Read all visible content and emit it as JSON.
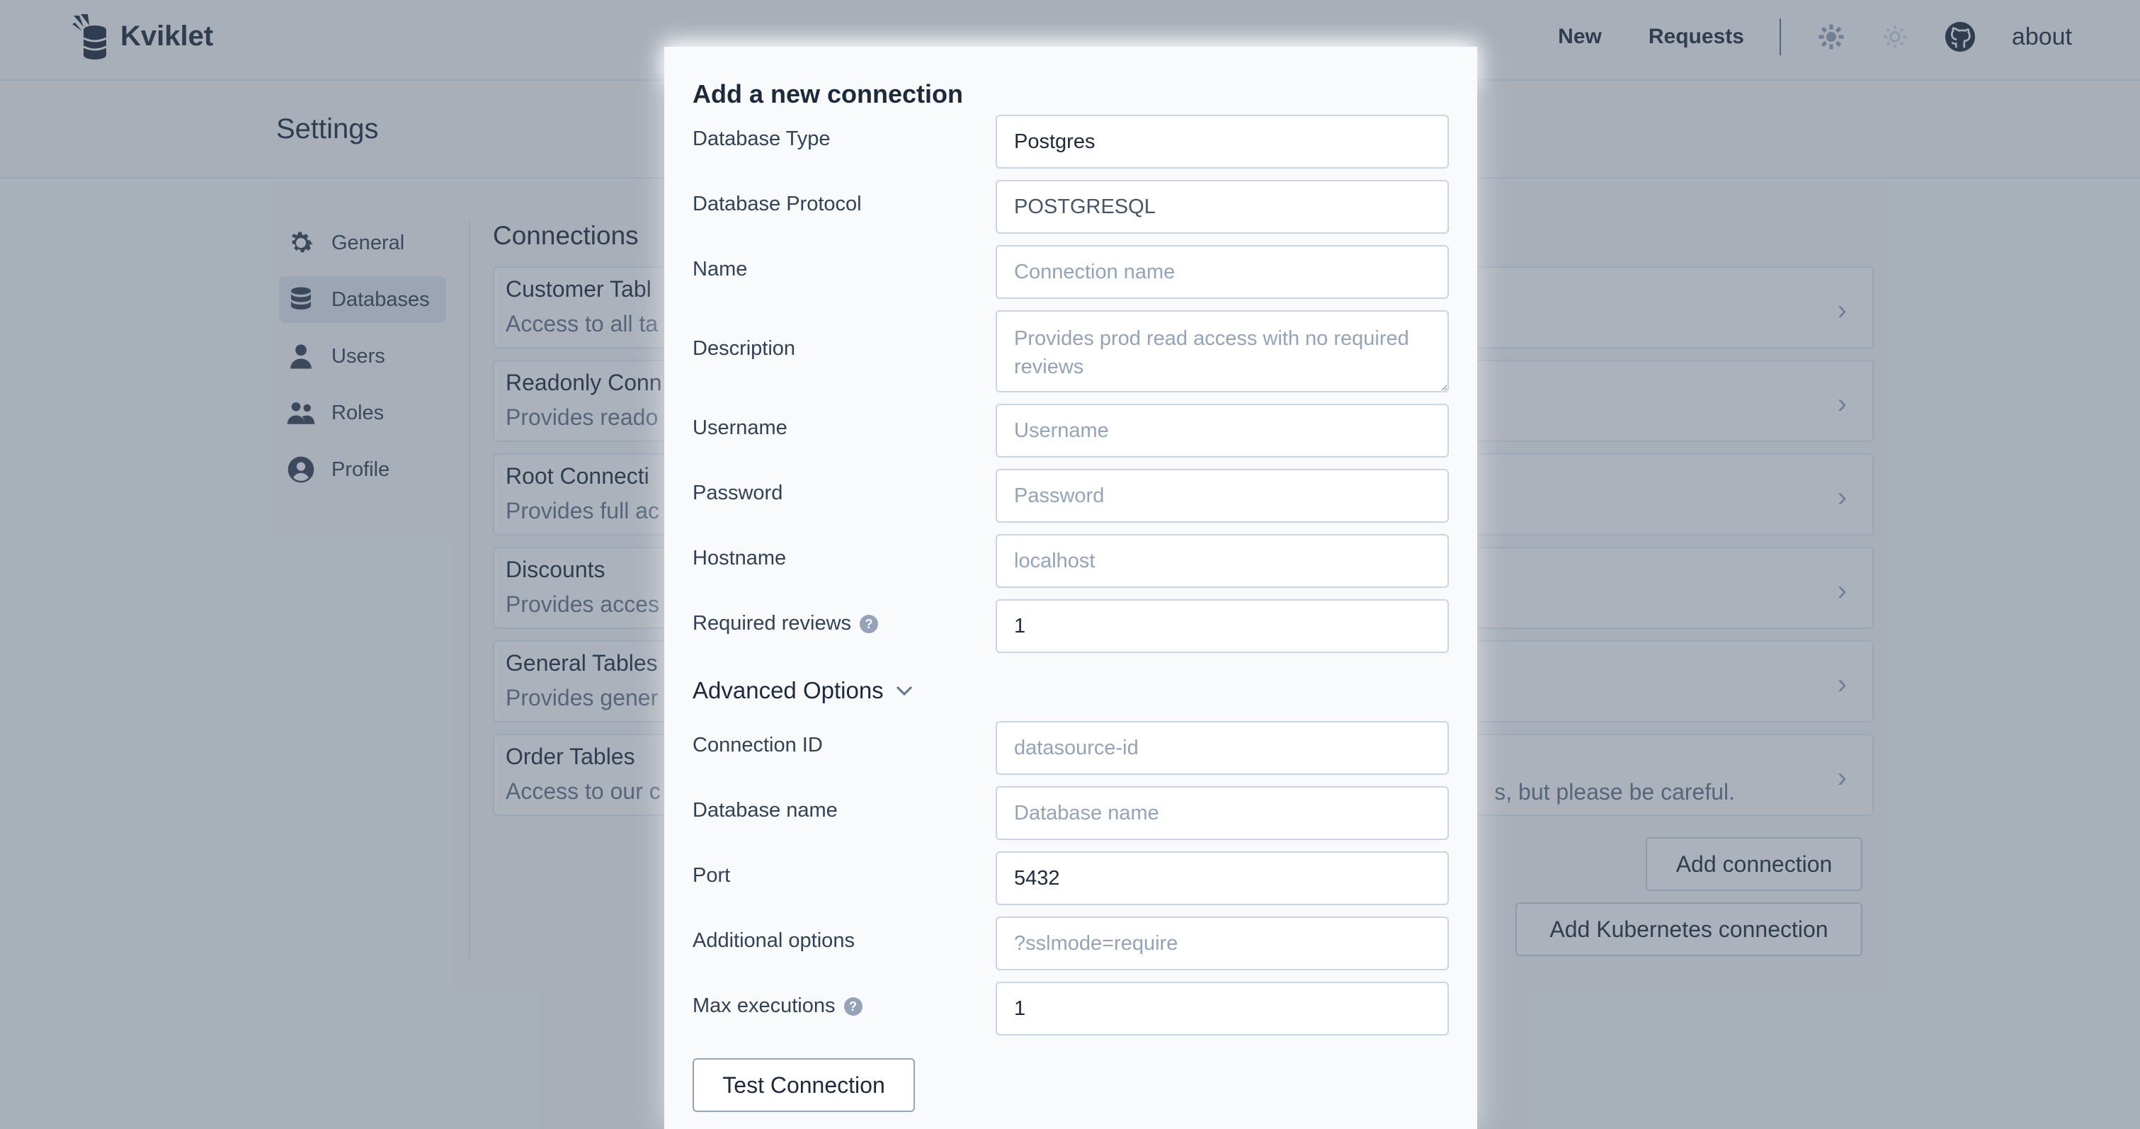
{
  "app": {
    "name": "Kviklet"
  },
  "nav": {
    "new": "New",
    "requests": "Requests",
    "about": "about"
  },
  "page": {
    "title": "Settings"
  },
  "sidebar": {
    "items": [
      {
        "label": "General",
        "icon": "gear-icon",
        "active": false
      },
      {
        "label": "Databases",
        "icon": "database-icon",
        "active": true
      },
      {
        "label": "Users",
        "icon": "user-icon",
        "active": false
      },
      {
        "label": "Roles",
        "icon": "users-icon",
        "active": false
      },
      {
        "label": "Profile",
        "icon": "user-circle-icon",
        "active": false
      }
    ]
  },
  "connections": {
    "heading": "Connections",
    "items": [
      {
        "title": "Customer Tabl",
        "desc": "Access to all ta"
      },
      {
        "title": "Readonly Conn",
        "desc": "Provides reado"
      },
      {
        "title": "Root Connecti",
        "desc": "Provides full ac"
      },
      {
        "title": "Discounts",
        "desc": "Provides acces"
      },
      {
        "title": "General Tables",
        "desc": "Provides gener"
      },
      {
        "title": "Order Tables",
        "desc": "Access to our c",
        "tail": "s, but please be careful."
      }
    ],
    "add_button": "Add connection",
    "add_k8s_button": "Add Kubernetes connection"
  },
  "modal": {
    "title": "Add a new connection",
    "fields": {
      "db_type": {
        "label": "Database Type",
        "value": "Postgres"
      },
      "db_protocol": {
        "label": "Database Protocol",
        "value": "POSTGRESQL"
      },
      "name": {
        "label": "Name",
        "placeholder": "Connection name"
      },
      "description": {
        "label": "Description",
        "placeholder": "Provides prod read access with no required reviews"
      },
      "username": {
        "label": "Username",
        "placeholder": "Username"
      },
      "password": {
        "label": "Password",
        "placeholder": "Password"
      },
      "hostname": {
        "label": "Hostname",
        "placeholder": "localhost"
      },
      "required_reviews": {
        "label": "Required reviews",
        "value": "1"
      },
      "connection_id": {
        "label": "Connection ID",
        "placeholder": "datasource-id"
      },
      "database_name": {
        "label": "Database name",
        "placeholder": "Database name"
      },
      "port": {
        "label": "Port",
        "value": "5432"
      },
      "additional_options": {
        "label": "Additional options",
        "placeholder": "?sslmode=require"
      },
      "max_executions": {
        "label": "Max executions",
        "value": "1"
      }
    },
    "advanced_label": "Advanced Options",
    "help_glyph": "?",
    "test_button": "Test Connection"
  }
}
